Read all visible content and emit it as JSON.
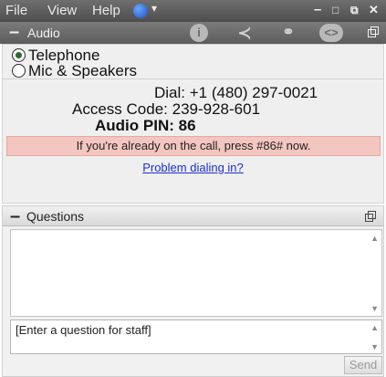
{
  "menubar": {
    "items": [
      "File",
      "View",
      "Help"
    ],
    "window_controls": [
      "–",
      "□",
      "⧉",
      "✕"
    ]
  },
  "audio": {
    "title": "Audio",
    "toolbar_icons": [
      "info-icon",
      "share-icon",
      "link-icon",
      "embed-icon"
    ],
    "options": [
      {
        "label": "Telephone",
        "selected": true
      },
      {
        "label": "Mic & Speakers",
        "selected": false
      }
    ],
    "dial": {
      "label": "Dial:",
      "value": "+1 (480) 297-0021"
    },
    "access_code": {
      "label": "Access Code:",
      "value": "239-928-601"
    },
    "audio_pin": {
      "label": "Audio PIN:",
      "value": "86"
    },
    "notice": "If you're already on the call, press #86# now.",
    "problem_link": "Problem dialing in?",
    "colors": {
      "notice_bg": "#f4c6c0",
      "link": "#1a2fd6"
    }
  },
  "questions": {
    "title": "Questions",
    "input_text": "[Enter a question for staff]",
    "send_label": "Send"
  }
}
